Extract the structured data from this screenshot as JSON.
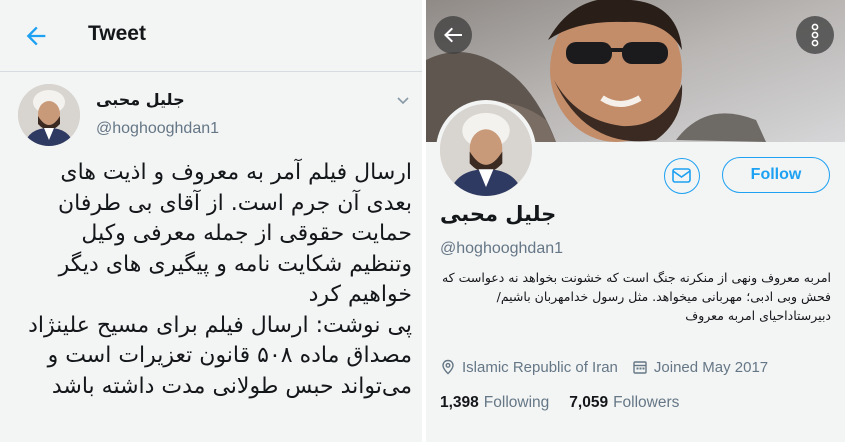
{
  "tweet_view": {
    "header_title": "Tweet",
    "author_name": "جلیل محبی",
    "author_handle": "@hoghooghdan1",
    "paragraphs": [
      "ارسال فیلم آمر به معروف و اذیت های بعدی آن جرم است. از آقای بی طرفان حمایت حقوقی از جمله معرفی وکیل وتنظیم شکایت نامه و پیگیری های دیگر خواهیم کرد",
      "پی نوشت: ارسال فیلم برای مسیح علینژاد مصداق ماده ۵۰۸ قانون تعزیرات است و می‌تواند حبس طولانی مدت داشته باشد"
    ],
    "icons": {
      "back": "back-arrow-icon",
      "caret": "chevron-down-icon"
    }
  },
  "profile_view": {
    "name": "جلیل محبی",
    "handle": "@hoghooghdan1",
    "follow_label": "Follow",
    "bio": "امربه معروف ونهی از منکرنه جنگ است که خشونت بخواهد نه دعواست که فحش وبی ادبی؛ مهربانی میخواهد. مثل رسول خدامهربان باشیم/ دبیرستاداحیای امربه معروف",
    "location": "Islamic Republic of Iran",
    "joined": "Joined May 2017",
    "following_count": "1,398",
    "following_label": "Following",
    "followers_count": "7,059",
    "followers_label": "Followers",
    "icons": {
      "back": "back-arrow-icon",
      "more": "more-vertical-icon",
      "mail": "mail-icon",
      "location": "location-pin-icon",
      "calendar": "calendar-icon"
    }
  },
  "colors": {
    "accent": "#1da1f2",
    "secondary_text": "#657786",
    "primary_text": "#14171a",
    "background": "#f3f4f4"
  }
}
